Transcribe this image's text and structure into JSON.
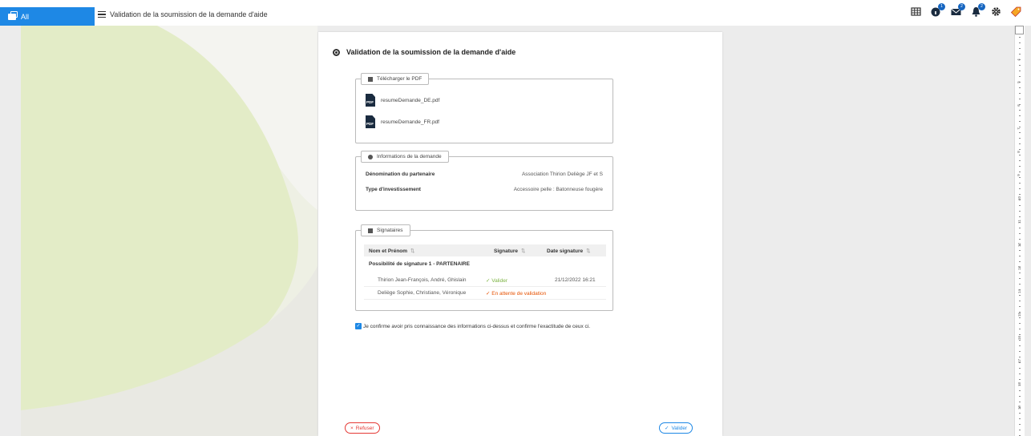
{
  "topbar": {
    "all_label": "All",
    "page_title": "Validation de la soumission de la demande d'aide",
    "badges": [
      "1",
      "2",
      "2"
    ],
    "icons": [
      "grid-icon",
      "info-icon",
      "mail-icon",
      "bell-icon",
      "gear-icon",
      "tag-icon"
    ]
  },
  "page": {
    "title": "Validation de la soumission de la demande d'aide"
  },
  "pdf_box": {
    "legend": "Télécharger le PDF",
    "files": [
      "resumeDemande_DE.pdf",
      "resumeDemande_FR.pdf"
    ]
  },
  "info_box": {
    "legend": "Informations de la demande",
    "rows": [
      {
        "label": "Dénomination du partenaire",
        "value": "Association Thirion Deliège JF et S"
      },
      {
        "label": "Type d'investissement",
        "value": "Accessoire pelle : Batonneuse fougère"
      }
    ]
  },
  "sig_box": {
    "legend": "Signataires",
    "headers": [
      "Nom et Prénom",
      "Signature",
      "Date signature"
    ],
    "sort_icon": "⇅",
    "group": "Possibilité de signature 1 - PARTENAIRE",
    "rows": [
      {
        "name": "Thirion Jean-François, André, Ghislain",
        "status": "Valider",
        "date": "21/12/2022 16:21"
      },
      {
        "name": "Deliège Sophie, Christiane, Véronique",
        "status": "En attente de validation",
        "date": ""
      }
    ]
  },
  "confirm_text": "Je confirme avoir pris connaissance des informations ci-dessus et confirme l'exactitude de ceux ci.",
  "buttons": {
    "refuse": "Refuser",
    "validate": "Valider"
  },
  "ruler": {
    "labels": [
      "4",
      "5",
      "6",
      "7",
      "8",
      "9",
      "10",
      "11",
      "12",
      "13",
      "14",
      "15",
      "16",
      "17",
      "18",
      "19"
    ]
  },
  "colors": {
    "accent": "#1e88e5",
    "ok": "#7cb342",
    "wait": "#e65100",
    "danger": "#e53935"
  }
}
